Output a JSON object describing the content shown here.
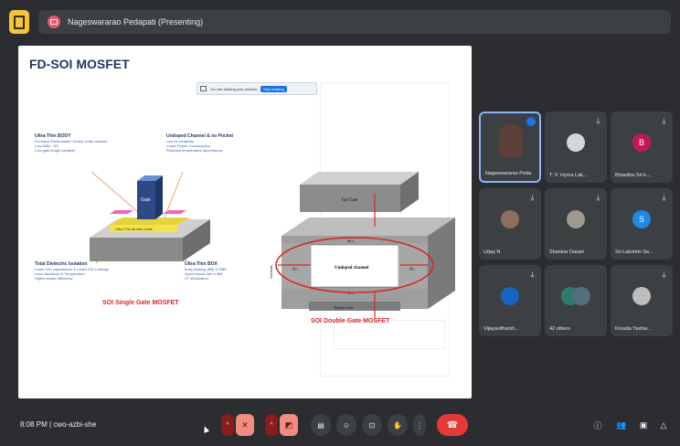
{
  "header": {
    "presenter": "Nageswararao Pedapati (Presenting)"
  },
  "slide": {
    "title": "FD-SOI MOSFET",
    "share_bar": {
      "text": "You are sharing your window",
      "stop_label": "Stop sharing"
    },
    "labels": {
      "ultra_thin_body_title": "Ultra-Thin BODY",
      "ultra_thin_body_lines": [
        "Excellent Electrostatic Control of the channel",
        "Low DIBL / SS",
        "Low gate length variation"
      ],
      "undoped_title": "Undoped Channel & no Pocket",
      "undoped_lines": [
        "Low Vt variability",
        "Lower Power Consumption",
        "Reduced temperature dependency"
      ],
      "dielectric_title": "Total Dielectric Isolation",
      "dielectric_lines": [
        "Lower S/D capacitance & Lower S/D Leakage",
        "Less Variations in Temperature",
        "Higher power efficiency"
      ],
      "box_title": "Ultra-Thin BOX",
      "box_lines": [
        "Body Biasing (BB) in DBE",
        "Speed boost due to BB",
        "VT Modulation"
      ],
      "gate": "Gate",
      "ultra_thin_buried_oxide": "Ultra-Thin Buried oxide",
      "top_gate": "Top Gate",
      "undoped_channel": "Undoped channel",
      "bottom_gate": "Bottom Gate",
      "sio2_top": "SiO₂",
      "sio2_bottom": "SiO₂",
      "n_plus_left": "N+",
      "n_plus_right": "N+",
      "substrate": "Substrate",
      "single_caption": "SOI Single Gate MOSFET",
      "double_caption": "SOI Double Gate MOSFET"
    }
  },
  "participants": [
    {
      "name": "Nageswararao Peda",
      "initial": "",
      "color": "#7a6a52",
      "self": true
    },
    {
      "name": "T. V. Hyma Lak...",
      "initial": "",
      "color": "#d6d6d6"
    },
    {
      "name": "Bhavitha Sri k...",
      "initial": "B",
      "color": "#c2185b"
    },
    {
      "name": "Uday N",
      "initial": "",
      "color": "#8d6e63"
    },
    {
      "name": "Shankar Dasari",
      "initial": "",
      "color": "#9e9a8f"
    },
    {
      "name": "Sri Lakshmi Sa...",
      "initial": "S",
      "color": "#1e88e5"
    },
    {
      "name": "Vijayavitharsh...",
      "initial": "",
      "color": "#1565c0"
    },
    {
      "name": "42 others",
      "initial": "",
      "color": "#2e7d6b"
    },
    {
      "name": "Korada Yashw...",
      "initial": "",
      "color": "#bdbdbd"
    }
  ],
  "bottom": {
    "time": "8:08 PM",
    "meeting_code": "cwo-azbi-she"
  },
  "colors": {
    "end_call": "#e53935",
    "mic_off": "#8a1c1c",
    "menu_accent": "#f3c53a"
  },
  "icons": [
    "menu-icon",
    "presenting-icon",
    "mic-off-icon",
    "camera-off-icon",
    "captions-icon",
    "emoji-icon",
    "present-icon",
    "raise-hand-icon",
    "more-icon",
    "end-call-icon",
    "info-icon",
    "people-icon",
    "chat-icon",
    "activities-icon"
  ]
}
